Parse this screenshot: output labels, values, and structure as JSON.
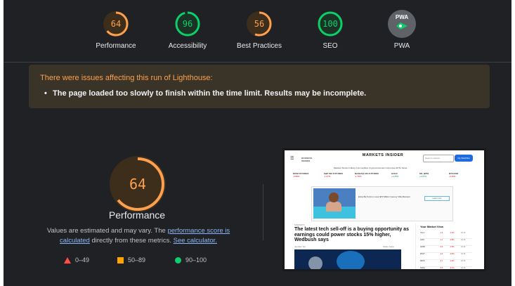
{
  "gauges": [
    {
      "label": "Performance",
      "value": "64",
      "score": 0.64,
      "color": "#fca04f",
      "bg": "#3d2e1c"
    },
    {
      "label": "Accessibility",
      "value": "96",
      "score": 0.96,
      "color": "#0cce6b",
      "bg": "#1a3324"
    },
    {
      "label": "Best Practices",
      "value": "56",
      "score": 0.56,
      "color": "#fca04f",
      "bg": "#3d2e1c"
    },
    {
      "label": "SEO",
      "value": "100",
      "score": 1.0,
      "color": "#0cce6b",
      "bg": "#1a3324"
    },
    {
      "label": "PWA",
      "badge_text": "PWA",
      "icon": "pwa-badge-icon"
    }
  ],
  "warning": {
    "title": "There were issues affecting this run of Lighthouse:",
    "items": [
      "The page loaded too slowly to finish within the time limit. Results may be incomplete."
    ]
  },
  "performance": {
    "score": "64",
    "score_fraction": 0.64,
    "title": "Performance",
    "desc_prefix": "Values are estimated and may vary. The ",
    "link_score": "performance score is calculated",
    "desc_middle": " directly from these metrics. ",
    "link_calc": "See calculator.",
    "legend": [
      {
        "icon": "red-triangle-icon",
        "range": "0–49",
        "color": "#ff4e42"
      },
      {
        "icon": "orange-square-icon",
        "range": "50–89",
        "color": "#ffa400"
      },
      {
        "icon": "green-circle-icon",
        "range": "90–100",
        "color": "#0cce6b"
      }
    ]
  },
  "screenshot": {
    "logo": "MARKETS INSIDER",
    "nav": "Markets   Stocks   Indices   Commodities   Cryptocurrencies   Currencies   ETFs   News",
    "search_placeholder": "Search markets",
    "button": "My Watchlist",
    "tickers": [
      {
        "name": "DOW FUTURES",
        "value": "-0.88%"
      },
      {
        "name": "S&P 500 FUTURES",
        "value": "-1.07%"
      },
      {
        "name": "NASDAQ 100 FUTURES",
        "value": "-1.79%"
      },
      {
        "name": "GOLD",
        "value": "+0.25%"
      },
      {
        "name": "OIL (WTI)",
        "value": "+0.57%"
      },
      {
        "name": "BTC/USD",
        "value": "-2.46%"
      }
    ],
    "ad_text": "Erica Ba Fortnry Lives $70 Million Genery Villa Mansion",
    "ad_button": "Learn more",
    "category": "MARKETS",
    "headline": "The latest tech sell-off is a buying opportunity as earnings could power stocks 15% higher, Wedbush says",
    "byline": "Jennifer Sor",
    "share": "Share   Save",
    "market_title": "Your Market View",
    "market_rows": [
      "TSLA",
      "AAPL",
      "AMZN",
      "MSFT",
      "META",
      "NVDA"
    ]
  }
}
